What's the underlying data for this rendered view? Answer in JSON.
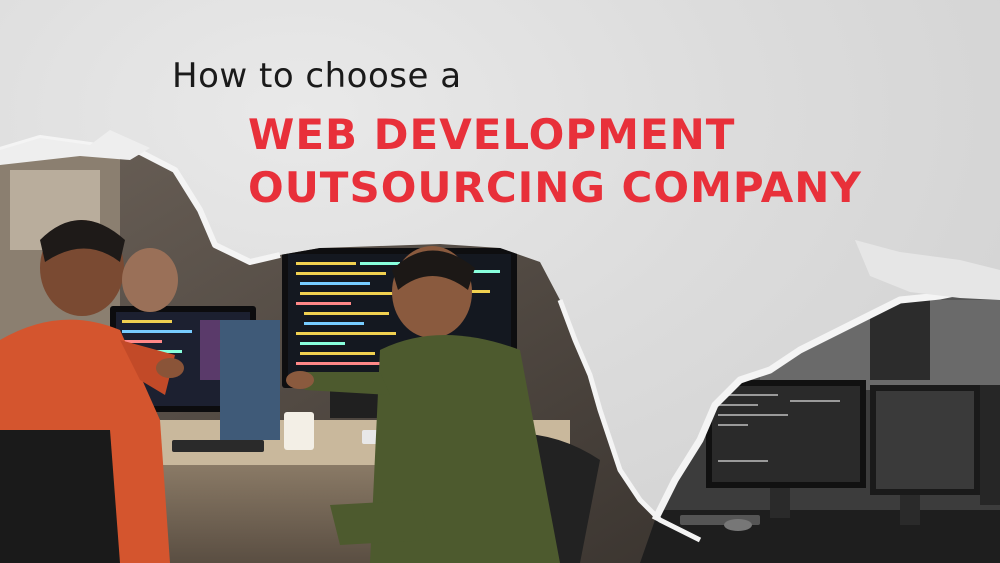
{
  "heading": {
    "intro": "How to choose a",
    "line1": "WEB DEVELOPMENT",
    "line2": "OUTSOURCING COMPANY"
  },
  "colors": {
    "accent": "#e8303a",
    "background": "#dcdcdc",
    "text": "#1a1a1a"
  }
}
